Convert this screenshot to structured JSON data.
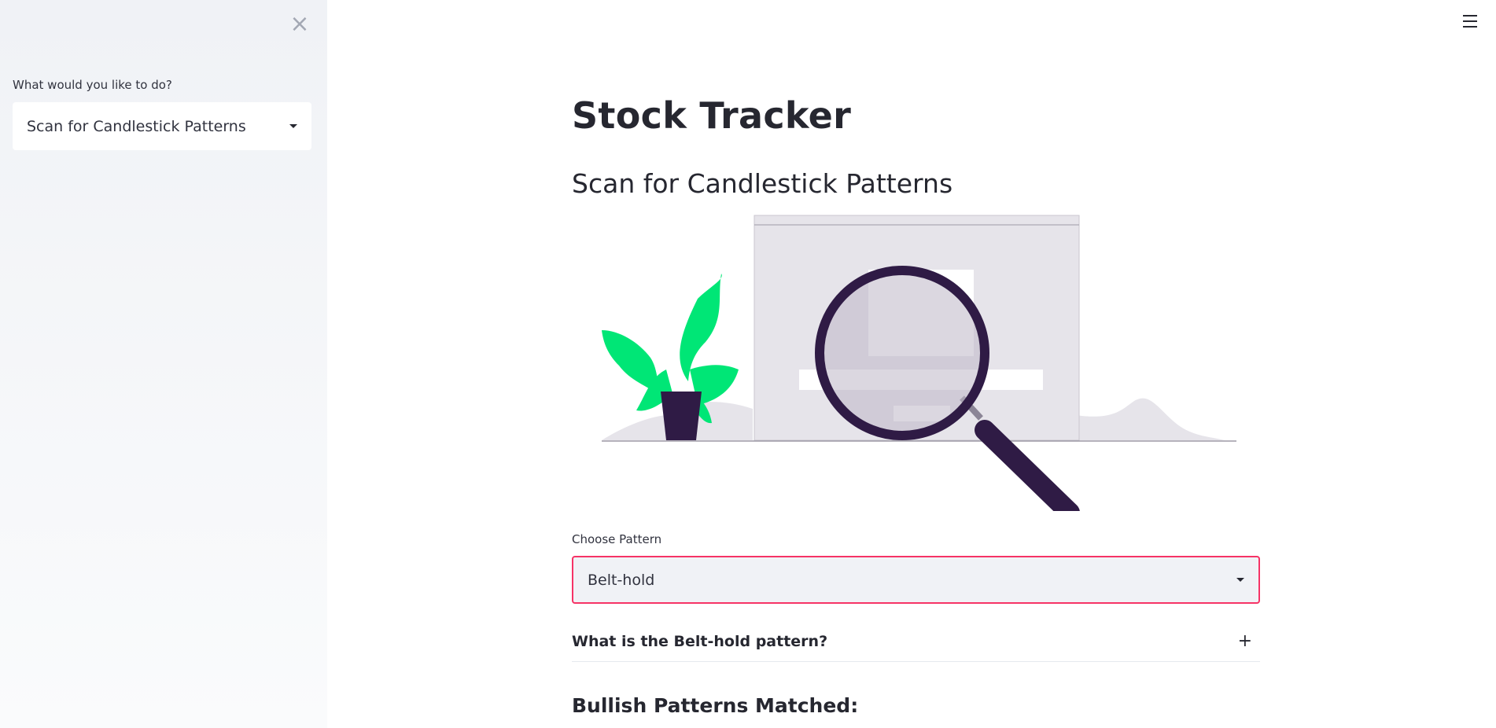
{
  "sidebar": {
    "close_icon": "×",
    "label": "What would you like to do?",
    "select_value": "Scan for Candlestick Patterns"
  },
  "header": {
    "menu_icon": "hamburger-menu-icon"
  },
  "main": {
    "title": "Stock Tracker",
    "subtitle": "Scan for Candlestick Patterns",
    "illustration": {
      "accent_color": "#00e676",
      "dark_color": "#2f1b45",
      "light_color": "#e6e4ea"
    },
    "pattern_label": "Choose Pattern",
    "pattern_value": "Belt-hold",
    "expander_title": "What is the Belt-hold pattern?",
    "expander_icon": "+",
    "section_heading": "Bullish Patterns Matched:"
  },
  "colors": {
    "focus_border": "#f63366",
    "sidebar_bg": "#f0f2f6"
  }
}
